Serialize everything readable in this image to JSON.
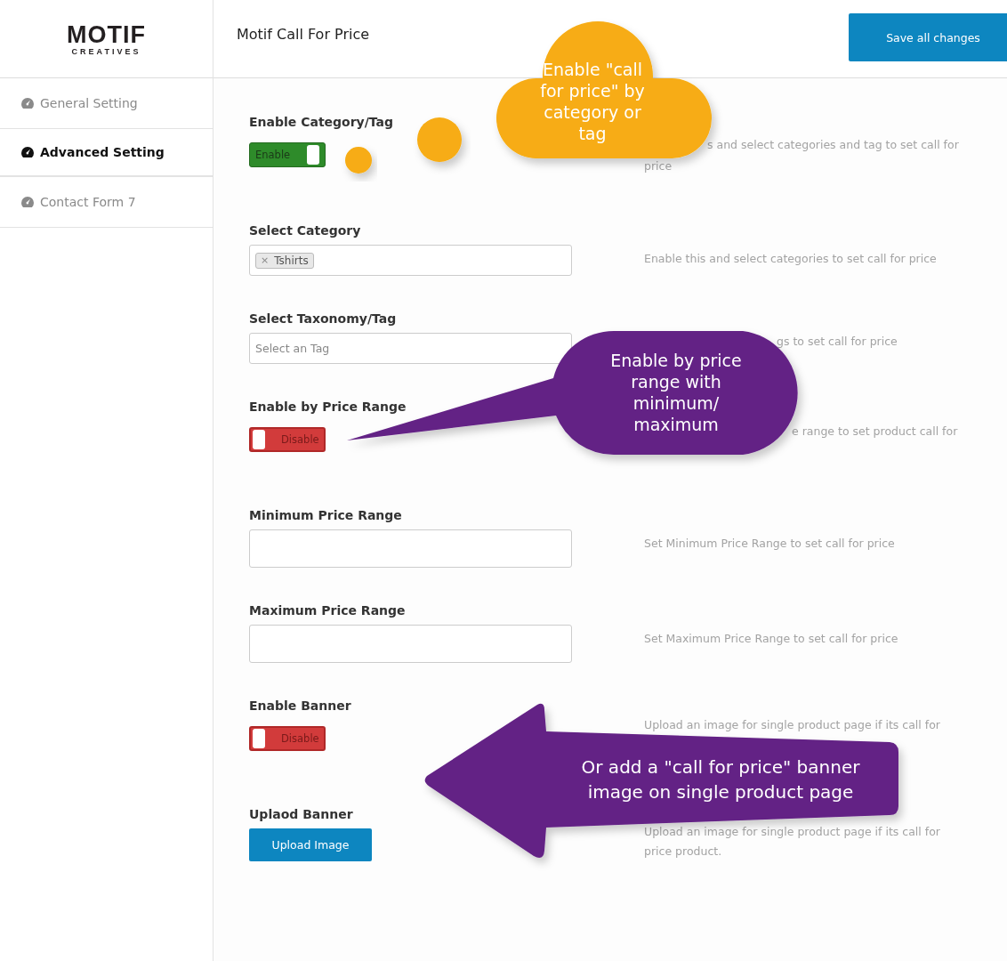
{
  "logo": {
    "wordmark": "MOTIF",
    "tagline": "CREATIVES"
  },
  "header": {
    "title": "Motif Call For Price",
    "save_button": "Save all changes"
  },
  "sidebar": {
    "items": [
      {
        "label": "General Setting",
        "selected": false
      },
      {
        "label": "Advanced Setting",
        "selected": true
      },
      {
        "label": "Contact Form 7",
        "selected": false
      }
    ]
  },
  "settings": [
    {
      "kind": "toggle",
      "label": "Enable Category/Tag",
      "on": true,
      "toggle_text": "Enable",
      "description_lines": [
        "s and select categories and tag to set call for",
        "price"
      ]
    },
    {
      "kind": "select",
      "label": "Select Category",
      "chips": [
        {
          "remove": "×",
          "text": "Tshirts"
        }
      ],
      "description": "Enable this and select categories to set call for price"
    },
    {
      "kind": "select",
      "label": "Select Taxonomy/Tag",
      "placeholder": "Select an Tag",
      "description": "gs to set call for price"
    },
    {
      "kind": "toggle",
      "label": "Enable by Price Range",
      "on": false,
      "toggle_text": "Disable",
      "description": "e range to set product call for"
    },
    {
      "kind": "text",
      "label": "Minimum Price Range",
      "description": "Set Minimum Price Range to set call for price"
    },
    {
      "kind": "text",
      "label": "Maximum Price Range",
      "description": "Set Maximum Price Range to set call for price"
    },
    {
      "kind": "toggle",
      "label": "Enable Banner",
      "on": false,
      "toggle_text": "Disable",
      "description": "Upload an image for single product page if its call for"
    },
    {
      "kind": "button",
      "label": "Uplaod Banner",
      "button_text": "Upload Image",
      "description": "Upload an image for single product page if its call for price product."
    }
  ],
  "callouts": [
    {
      "kind": "cloud",
      "text": "Enable \"call for price\" by category or tag"
    },
    {
      "kind": "bubble",
      "text": "Enable by price range with minimum/ maximum"
    },
    {
      "kind": "arrow",
      "text": "Or add a \"call for price\" banner image on single product page"
    }
  ]
}
